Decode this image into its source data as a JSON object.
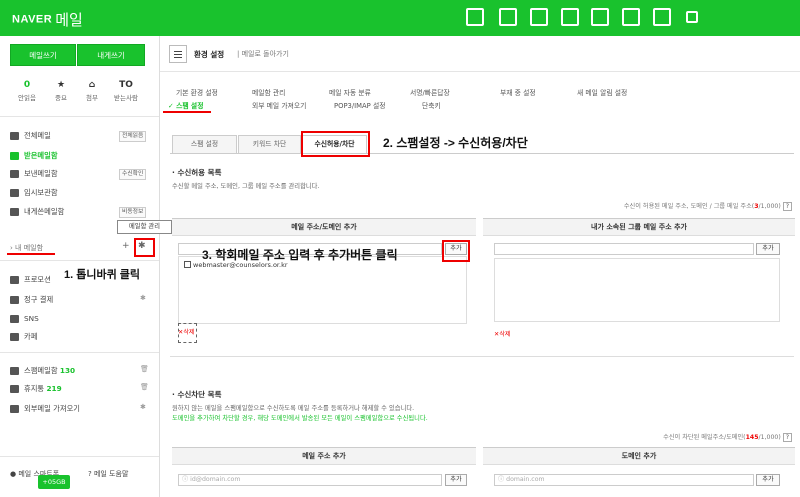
{
  "brand": {
    "naver": "NAVER",
    "mail": "메일"
  },
  "colors": {
    "green": "#19c22d",
    "red": "#e00000"
  },
  "topbar_icons": [
    "mail-check-icon",
    "calendar-icon",
    "list-icon",
    "contacts-icon",
    "box-icon",
    "grid-icon",
    "home-icon",
    "more-icon"
  ],
  "sidebar": {
    "write_mail": "메일쓰기",
    "write_self": "내게쓰기",
    "quick": [
      {
        "count": "0",
        "label": "안읽음"
      },
      {
        "count": "★",
        "label": "중요"
      },
      {
        "count": "⌂",
        "label": "첨부"
      },
      {
        "count": "TO",
        "label": "받는사람"
      }
    ],
    "folders": [
      {
        "label": "전체메일",
        "btn": "전체읽음"
      },
      {
        "label": "받은메일함",
        "btn": ""
      },
      {
        "label": "보낸메일함",
        "btn": "수신확인"
      },
      {
        "label": "임시보관함",
        "btn": ""
      },
      {
        "label": "내게쓴메일함",
        "btn": "비동정보"
      }
    ],
    "tooltip": "메일함 관리",
    "my_folder": "내 메일함",
    "mid_items": [
      {
        "label": "프로모션"
      },
      {
        "label": "정구 결제"
      },
      {
        "label": "SNS"
      },
      {
        "label": "카페"
      }
    ],
    "bottom_items": [
      {
        "label": "스팸메일함",
        "count": "130"
      },
      {
        "label": "휴지통",
        "count": "219"
      },
      {
        "label": "외부메일 가져오기",
        "count": ""
      }
    ],
    "footer": {
      "left": "메일 스마트폰",
      "right": "메일 도움말",
      "badge": "+05GB"
    }
  },
  "main": {
    "header": {
      "title": "환경 설정",
      "back": "메일로 돌아가기"
    },
    "tabs_row1": [
      "기본 환경 설정",
      "메일함 관리",
      "메일 자동 분류",
      "서명/빠른답장",
      "부재 중 설정",
      "새 메일 알림 설정"
    ],
    "tabs_row2": [
      "스팸 설정",
      "외부 메일 가져오기",
      "POP3/IMAP 설정",
      "단축키"
    ],
    "sub_tabs": [
      "스팸 설정",
      "키워드 차단",
      "수신허용/차단"
    ],
    "allow": {
      "title": "수신허용 목록",
      "desc": "수신할 메일 주소, 도메인, 그룹 메일 주소를 관리합니다.",
      "info_prefix": "수신이 허용된 메일 주소, 도메인 / 그룹 메일 주소(",
      "info_count": "3",
      "info_suffix": "/1,000)",
      "col_left": "메일 주소/도메인 추가",
      "col_right": "내가 소속된 그룹 메일 주소 추가",
      "add_label": "추가",
      "entry": "webmaster@counselors.or.kr",
      "delete_label": "삭제"
    },
    "block": {
      "title": "수신차단 목록",
      "desc1": "원하지 않는 메일을 스팸메일함으로 수신하도록 메일 주소를 등록하거나 해제할 수 있습니다.",
      "desc2": "도메인을 추가하여 차단할 경우, 해당 도메인에서 발송된 모든 메일이 스팸메일함으로 수신됩니다.",
      "info_prefix": "수신이 차단된 메일주소/도메인(",
      "info_count": "145",
      "info_suffix": "/1,000)",
      "col_left": "메일 주소 추가",
      "col_right": "도메인 추가",
      "ph_left": "id@domain.com",
      "ph_right": "domain.com",
      "add_label": "추가"
    }
  },
  "annotations": {
    "step1": "1. 톱니바퀴 클릭",
    "step2": "2. 스팸설정 -> 수신허용/차단",
    "step3": "3. 학회메일 주소 입력 후 추가버튼 클릭"
  }
}
